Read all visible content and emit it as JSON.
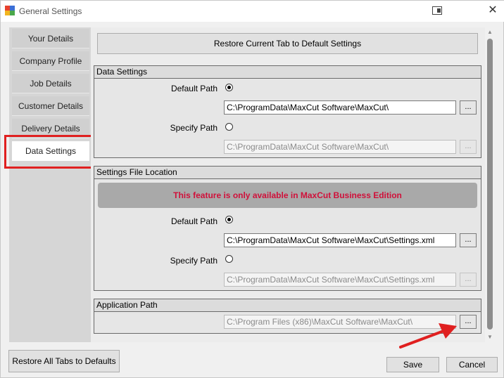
{
  "window": {
    "title": "General Settings",
    "close_symbol": "✕"
  },
  "sidebar": {
    "items": [
      {
        "label": "Your Details"
      },
      {
        "label": "Company Profile"
      },
      {
        "label": "Job Details"
      },
      {
        "label": "Customer Details"
      },
      {
        "label": "Delivery Details"
      },
      {
        "label": "Data Settings",
        "active": true
      }
    ]
  },
  "restore_tab_label": "Restore Current Tab to Default Settings",
  "data_settings": {
    "header": "Data Settings",
    "default_path_label": "Default Path",
    "default_path_value": "C:\\ProgramData\\MaxCut Software\\MaxCut\\",
    "specify_path_label": "Specify Path",
    "specify_path_value": "C:\\ProgramData\\MaxCut Software\\MaxCut\\",
    "browse_label": "..."
  },
  "settings_file": {
    "header": "Settings File Location",
    "banner": "This feature is only available in MaxCut Business Edition",
    "banner_color": "#d0103a",
    "default_path_label": "Default Path",
    "default_path_value": "C:\\ProgramData\\MaxCut Software\\MaxCut\\Settings.xml",
    "specify_path_label": "Specify Path",
    "specify_path_value": "C:\\ProgramData\\MaxCut Software\\MaxCut\\Settings.xml",
    "browse_label": "..."
  },
  "application_path": {
    "header": "Application Path",
    "value": "C:\\Program Files (x86)\\MaxCut Software\\MaxCut\\",
    "browse_label": "..."
  },
  "footer": {
    "restore_all_label": "Restore All Tabs to Defaults",
    "save_label": "Save",
    "cancel_label": "Cancel"
  },
  "annotation_colors": {
    "highlight": "#e02020"
  }
}
